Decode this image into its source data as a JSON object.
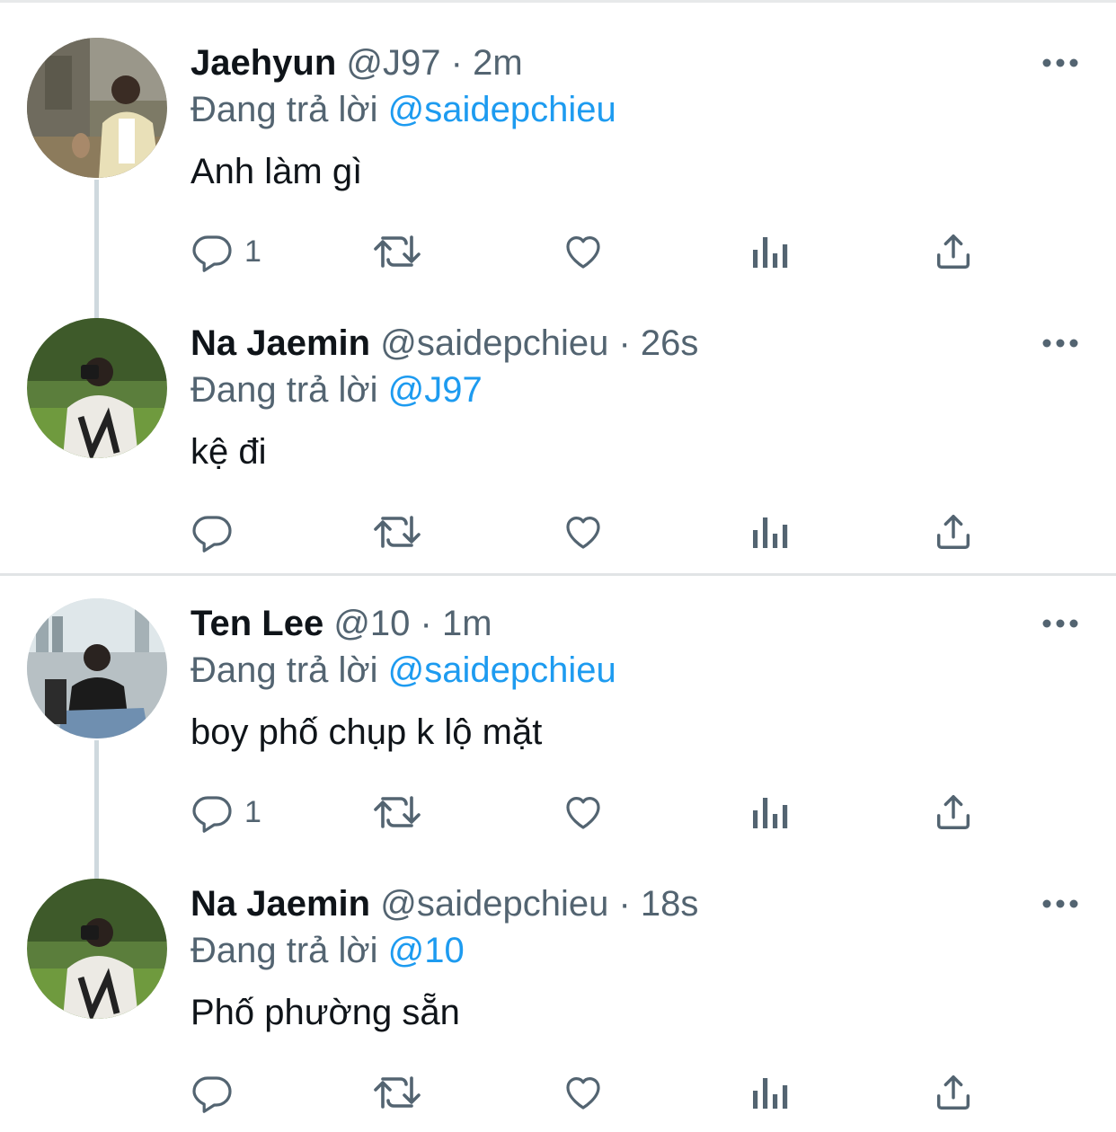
{
  "colors": {
    "text": "#0f1419",
    "secondary": "#536471",
    "link": "#1d9bf0",
    "thread_line": "#cfd9de"
  },
  "tweets": [
    {
      "name": "Jaehyun",
      "handle": "@J97",
      "dot": "·",
      "time": "2m",
      "replying_prefix": "Đang trả lời",
      "replying_to": "@saidepchieu",
      "text": "Anh làm gì",
      "reply_count": "1",
      "avatar": "jaehyun-photo"
    },
    {
      "name": "Na Jaemin",
      "handle": "@saidepchieu",
      "dot": "·",
      "time": "26s",
      "replying_prefix": "Đang trả lời",
      "replying_to": "@J97",
      "text": "kệ đi",
      "reply_count": "",
      "avatar": "jaemin-photo"
    },
    {
      "name": "Ten Lee",
      "handle": "@10",
      "dot": "·",
      "time": "1m",
      "replying_prefix": "Đang trả lời",
      "replying_to": "@saidepchieu",
      "text": "boy phố chụp k lộ mặt",
      "reply_count": "1",
      "avatar": "tenlee-photo"
    },
    {
      "name": "Na Jaemin",
      "handle": "@saidepchieu",
      "dot": "·",
      "time": "18s",
      "replying_prefix": "Đang trả lời",
      "replying_to": "@10",
      "text": "Phố phường sẵn",
      "reply_count": "",
      "avatar": "jaemin-photo"
    }
  ],
  "icons": {
    "reply": "reply-icon",
    "retweet": "retweet-icon",
    "like": "heart-icon",
    "views": "analytics-icon",
    "share": "share-icon",
    "more": "more-icon"
  }
}
